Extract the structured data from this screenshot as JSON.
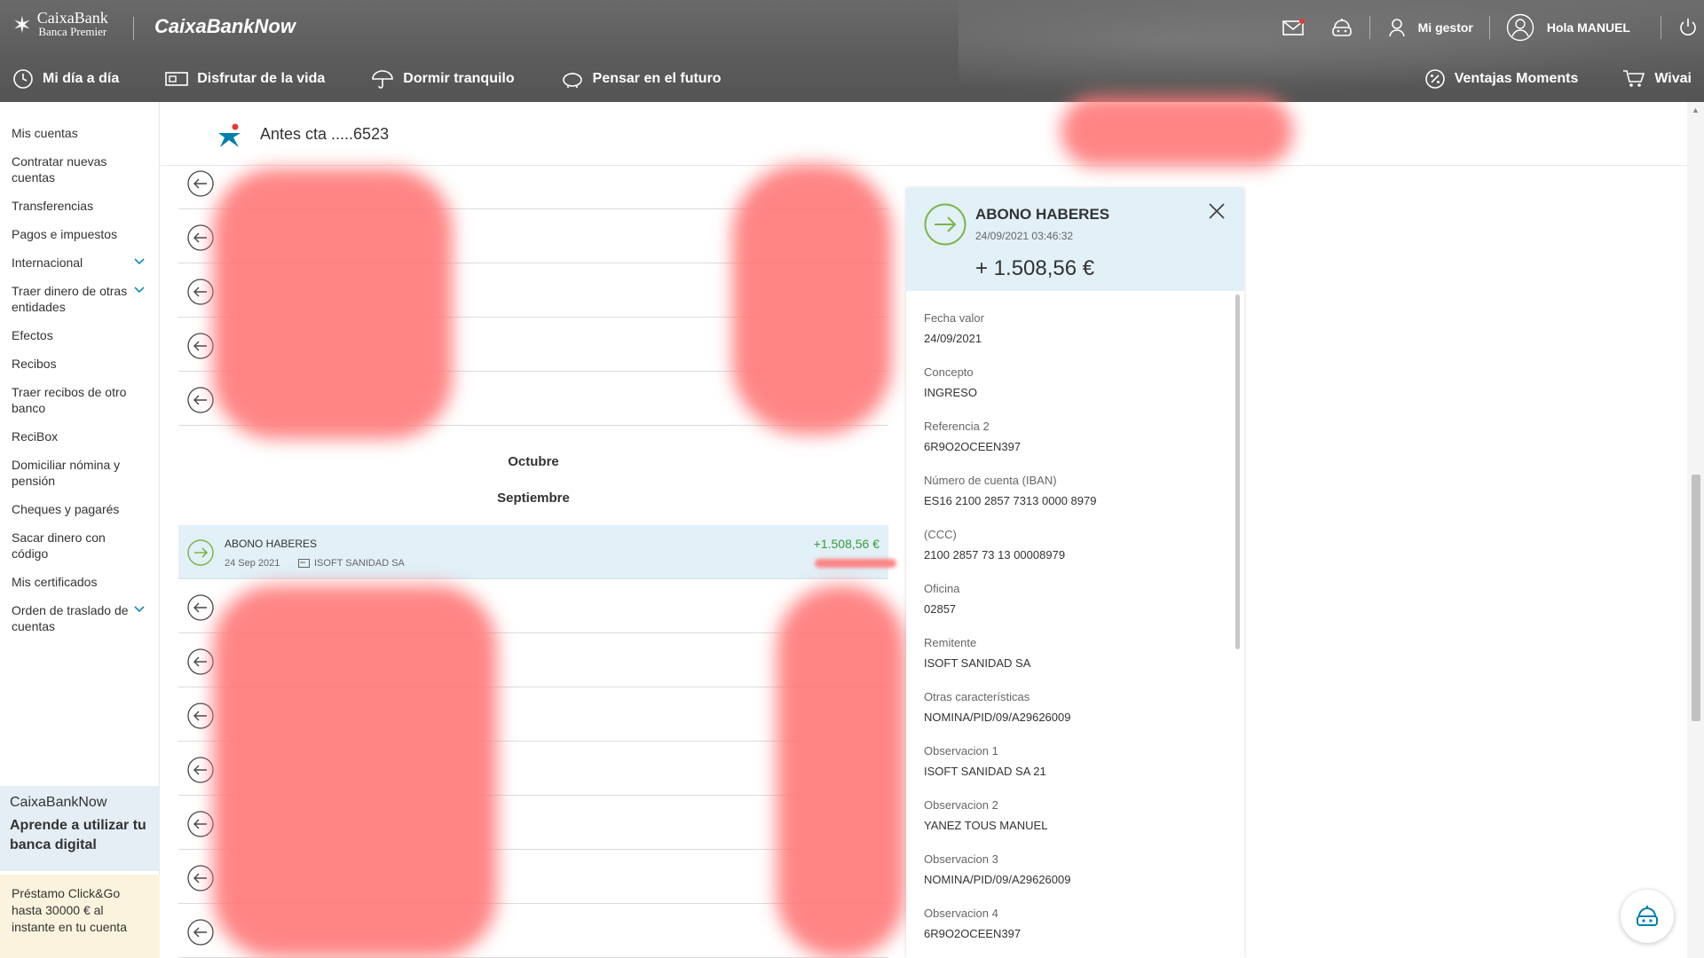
{
  "header": {
    "brand_name": "CaixaBank",
    "brand_sub": "Banca Premier",
    "product": "CaixaBankNow",
    "tools": {
      "gestor": "Mi gestor",
      "greeting": "Hola MANUEL"
    }
  },
  "nav": {
    "left": [
      "Mi día a día",
      "Disfrutar de la vida",
      "Dormir tranquilo",
      "Pensar en el futuro"
    ],
    "right": [
      "Ventajas Moments",
      "Wivai"
    ]
  },
  "sidebar": {
    "items": [
      {
        "label": "Mis cuentas",
        "has_chevron": false
      },
      {
        "label": "Contratar nuevas cuentas",
        "has_chevron": false
      },
      {
        "label": "Transferencias",
        "has_chevron": false
      },
      {
        "label": "Pagos e impuestos",
        "has_chevron": false
      },
      {
        "label": "Internacional",
        "has_chevron": true
      },
      {
        "label": "Traer dinero de otras entidades",
        "has_chevron": true
      },
      {
        "label": "Efectos",
        "has_chevron": false
      },
      {
        "label": "Recibos",
        "has_chevron": false
      },
      {
        "label": "Traer recibos de otro banco",
        "has_chevron": false
      },
      {
        "label": "ReciBox",
        "has_chevron": false
      },
      {
        "label": "Domiciliar nómina y pensión",
        "has_chevron": false
      },
      {
        "label": "Cheques y pagarés",
        "has_chevron": false
      },
      {
        "label": "Sacar dinero con código",
        "has_chevron": false
      },
      {
        "label": "Mis certificados",
        "has_chevron": false
      },
      {
        "label": "Orden de traslado de cuentas",
        "has_chevron": true
      }
    ],
    "promo_title": "CaixaBankNow",
    "promo_text": "Aprende a utilizar tu banca digital",
    "loan_text": "Préstamo Click&Go hasta 30000 € al instante en tu cuenta"
  },
  "account": {
    "title": "Antes cta .....6523"
  },
  "months": [
    "Octubre",
    "Septiembre"
  ],
  "selected_transaction": {
    "title": "ABONO HABERES",
    "date": "24 Sep 2021",
    "sender": "ISOFT SANIDAD SA",
    "amount": "+1.508,56 €"
  },
  "detail": {
    "title": "ABONO HABERES",
    "timestamp": "24/09/2021 03:46:32",
    "amount": "+ 1.508,56 €",
    "fields": [
      {
        "label": "Fecha valor",
        "value": "24/09/2021"
      },
      {
        "label": "Concepto",
        "value": "INGRESO"
      },
      {
        "label": "Referencia 2",
        "value": "6R9O2OCEEN397"
      },
      {
        "label": "Número de cuenta (IBAN)",
        "value": "ES16 2100 2857 7313 0000 8979"
      },
      {
        "label": "(CCC)",
        "value": "2100 2857 73 13 00008979"
      },
      {
        "label": "Oficina",
        "value": "02857"
      },
      {
        "label": "Remitente",
        "value": "ISOFT SANIDAD SA"
      },
      {
        "label": "Otras características",
        "value": "NOMINA/PID/09/A29626009"
      },
      {
        "label": "Observacion 1",
        "value": "ISOFT SANIDAD SA 21"
      },
      {
        "label": "Observacion 2",
        "value": "YANEZ TOUS MANUEL"
      },
      {
        "label": "Observacion 3",
        "value": "NOMINA/PID/09/A29626009"
      },
      {
        "label": "Observacion 4",
        "value": "6R9O2OCEEN397"
      }
    ]
  },
  "colors": {
    "header_bg": "#5c5c5c",
    "accent_blue": "#007eae",
    "positive_green": "#3a9a3a",
    "selected_bg": "#e2f0f8",
    "redaction": "#ff7878"
  }
}
